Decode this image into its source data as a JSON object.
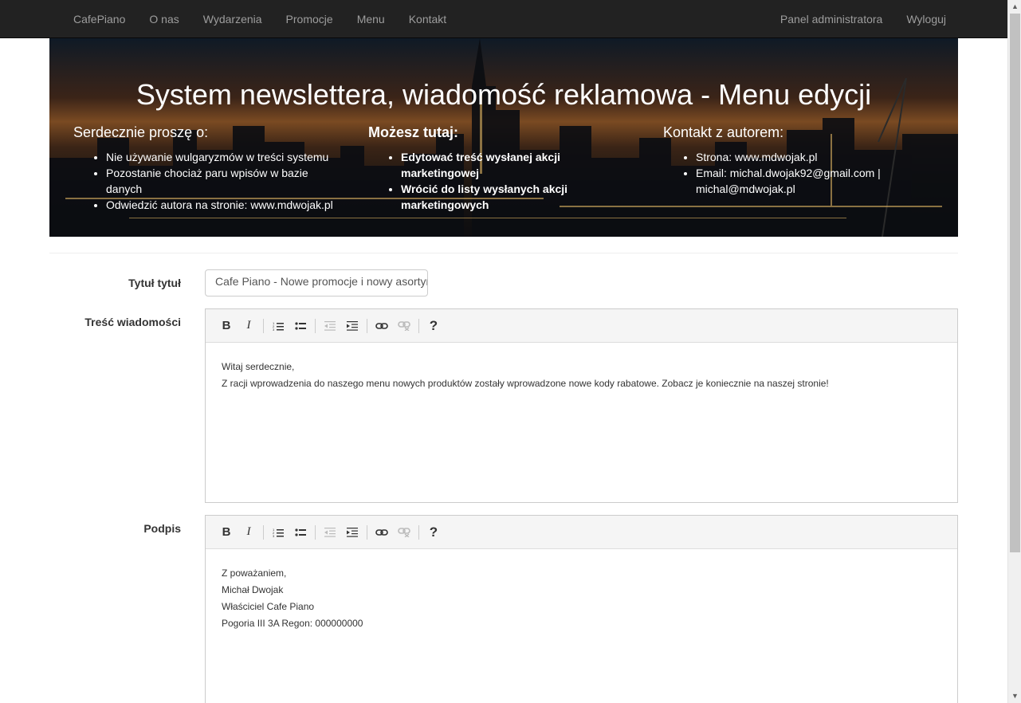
{
  "nav": {
    "left": [
      "CafePiano",
      "O nas",
      "Wydarzenia",
      "Promocje",
      "Menu",
      "Kontakt"
    ],
    "right": [
      "Panel administratora",
      "Wyloguj"
    ]
  },
  "hero": {
    "title": "System newslettera, wiadomość reklamowa - Menu edycji",
    "col1": {
      "heading": "Serdecznie proszę o:",
      "items": [
        "Nie używanie wulgaryzmów w treści systemu",
        "Pozostanie chociaż paru wpisów w bazie danych",
        "Odwiedzić autora na stronie: www.mdwojak.pl"
      ]
    },
    "col2": {
      "heading": "Możesz tutaj:",
      "items": [
        "Edytować treść wysłanej akcji marketingowej",
        "Wrócić do listy wysłanych akcji marketingowych"
      ]
    },
    "col3": {
      "heading": "Kontakt z autorem:",
      "items": [
        "Strona: www.mdwojak.pl",
        "Email: michal.dwojak92@gmail.com | michal@mdwojak.pl"
      ]
    }
  },
  "form": {
    "title_label": "Tytuł tytuł",
    "title_value": "Cafe Piano - Nowe promocje i nowy asortyment",
    "content_label": "Treść wiadomości",
    "content_lines": [
      "Witaj serdecznie,",
      "Z racji wprowadzenia do naszego menu nowych produktów zostały wprowadzone nowe kody rabatowe. Zobacz je koniecznie na naszej stronie!"
    ],
    "signature_label": "Podpis",
    "signature_lines": [
      "Z poważaniem,",
      "Michał Dwojak",
      "Właściciel Cafe Piano",
      "Pogoria III 3A Regon: 000000000"
    ]
  },
  "toolbar_icons": [
    "bold-icon",
    "italic-icon",
    "ordered-list-icon",
    "unordered-list-icon",
    "outdent-icon",
    "indent-icon",
    "link-icon",
    "unlink-icon",
    "help-icon"
  ],
  "toolbar_glyphs": {
    "bold": "B",
    "italic": "I",
    "help": "?"
  }
}
